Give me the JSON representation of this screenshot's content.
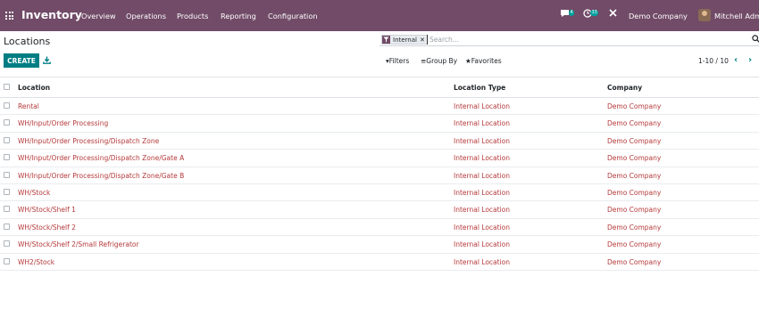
{
  "navbar": {
    "app_name": "Inventory",
    "menu": [
      "Overview",
      "Operations",
      "Products",
      "Reporting",
      "Configuration"
    ],
    "messages_count": "4",
    "activities_count": "33",
    "company": "Demo Company",
    "user": "Mitchell Admin"
  },
  "control_panel": {
    "title": "Locations",
    "facet_label": "Internal",
    "search_placeholder": "Search...",
    "create_label": "CREATE",
    "filters_label": "Filters",
    "groupby_label": "Group By",
    "favorites_label": "Favorites",
    "pager_value": "1-10 / 10"
  },
  "table": {
    "columns": [
      "Location",
      "Location Type",
      "Company"
    ],
    "rows": [
      [
        "Rental",
        "Internal Location",
        "Demo Company"
      ],
      [
        "WH/Input/Order Processing",
        "Internal Location",
        "Demo Company"
      ],
      [
        "WH/Input/Order Processing/Dispatch Zone",
        "Internal Location",
        "Demo Company"
      ],
      [
        "WH/Input/Order Processing/Dispatch Zone/Gate A",
        "Internal Location",
        "Demo Company"
      ],
      [
        "WH/Input/Order Processing/Dispatch Zone/Gate B",
        "Internal Location",
        "Demo Company"
      ],
      [
        "WH/Stock",
        "Internal Location",
        "Demo Company"
      ],
      [
        "WH/Stock/Shelf 1",
        "Internal Location",
        "Demo Company"
      ],
      [
        "WH/Stock/Shelf 2",
        "Internal Location",
        "Demo Company"
      ],
      [
        "WH/Stock/Shelf 2/Small Refrigerator",
        "Internal Location",
        "Demo Company"
      ],
      [
        "WH2/Stock",
        "Internal Location",
        "Demo Company"
      ]
    ]
  },
  "colors": {
    "navbar": "#714B67",
    "primary_button": "#017E84",
    "link_text": "#B5393A"
  },
  "icons": {
    "apps": "grid-icon",
    "messages": "chat-icon",
    "activities": "clock-icon",
    "debug": "tools-icon",
    "facet": "filter-icon",
    "download": "download-icon",
    "search": "search-icon"
  }
}
